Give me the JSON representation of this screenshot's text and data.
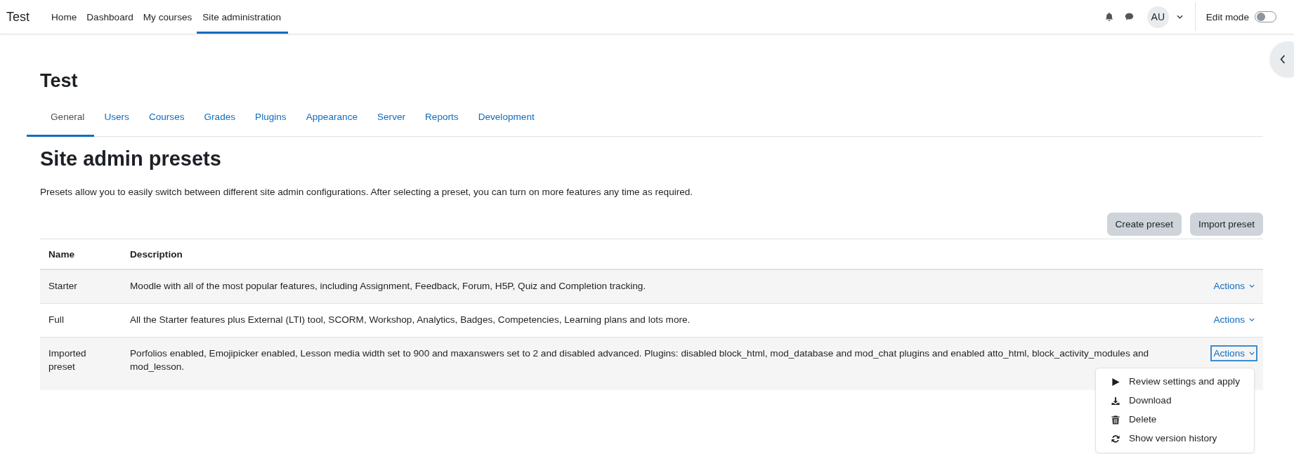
{
  "navbar": {
    "brand": "Test",
    "items": [
      {
        "label": "Home",
        "selected": false
      },
      {
        "label": "Dashboard",
        "selected": false
      },
      {
        "label": "My courses",
        "selected": false
      },
      {
        "label": "Site administration",
        "selected": true
      }
    ],
    "avatar": "AU",
    "edit_mode": {
      "label": "Edit mode",
      "on": false
    }
  },
  "page_title": "Test",
  "tabs": [
    {
      "label": "General",
      "selected": true
    },
    {
      "label": "Users",
      "selected": false
    },
    {
      "label": "Courses",
      "selected": false
    },
    {
      "label": "Grades",
      "selected": false
    },
    {
      "label": "Plugins",
      "selected": false
    },
    {
      "label": "Appearance",
      "selected": false
    },
    {
      "label": "Server",
      "selected": false
    },
    {
      "label": "Reports",
      "selected": false
    },
    {
      "label": "Development",
      "selected": false
    }
  ],
  "heading": "Site admin presets",
  "intro": "Presets allow you to easily switch between different site admin configurations. After selecting a preset, you can turn on more features any time as required.",
  "buttons": [
    "Create preset",
    "Import preset"
  ],
  "table": {
    "columns": [
      "Name",
      "Description"
    ],
    "rows": [
      {
        "name": "Starter",
        "description": "Moodle with all of the most popular features, including Assignment, Feedback, Forum, H5P, Quiz and Completion tracking.",
        "action": "Actions",
        "expanded": false
      },
      {
        "name": "Full",
        "description": "All the Starter features plus External (LTI) tool, SCORM, Workshop, Analytics, Badges, Competencies, Learning plans and lots more.",
        "action": "Actions",
        "expanded": false
      },
      {
        "name": "Imported preset",
        "description": "Porfolios enabled, Emojipicker enabled, Lesson media width set to 900 and maxanswers set to 2 and disabled advanced. Plugins: disabled block_html, mod_database and mod_chat plugins and enabled atto_html, block_activity_modules and mod_lesson.",
        "action": "Actions",
        "expanded": true
      }
    ]
  },
  "actions_menu": [
    {
      "kind": "play",
      "label": "Review settings and apply"
    },
    {
      "kind": "download",
      "label": "Download"
    },
    {
      "kind": "trash",
      "label": "Delete"
    },
    {
      "kind": "refresh",
      "label": "Show version history"
    }
  ]
}
